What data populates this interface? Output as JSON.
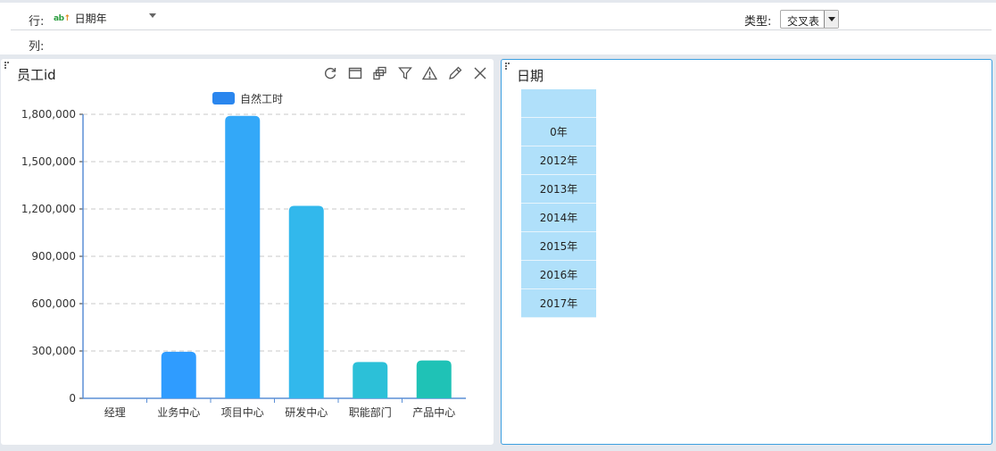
{
  "toolbar": {
    "row_label": "行:",
    "row_field": "日期年",
    "row_field_icon": "abc-text-field-icon",
    "col_label": "列:",
    "type_label": "类型:",
    "type_value": "交叉表"
  },
  "left_panel": {
    "title": "员工id",
    "tools": [
      "refresh-icon",
      "maximize-icon",
      "drill-icon",
      "filter-icon",
      "warning-icon",
      "edit-icon",
      "close-icon"
    ]
  },
  "chart_data": {
    "type": "bar",
    "categories": [
      "经理",
      "业务中心",
      "项目中心",
      "研发中心",
      "职能部门",
      "产品中心"
    ],
    "series": [
      {
        "name": "自然工时",
        "values": [
          0,
          295000,
          1790000,
          1220000,
          230000,
          240000
        ]
      }
    ],
    "colors": [
      "#3399ff",
      "#2f9cff",
      "#33a8f8",
      "#32b8ec",
      "#2cc0d8",
      "#1fc2b6"
    ],
    "legend_color": "#2a86ee",
    "y_ticks": [
      "0",
      "300,000",
      "600,000",
      "900,000",
      "1,200,000",
      "1,500,000",
      "1,800,000"
    ],
    "ylim": [
      0,
      1800000
    ],
    "grid": true,
    "legend": "top-center"
  },
  "right_panel": {
    "title": "日期",
    "header_cell": "",
    "rows": [
      "0年",
      "2012年",
      "2013年",
      "2014年",
      "2015年",
      "2016年",
      "2017年"
    ]
  }
}
